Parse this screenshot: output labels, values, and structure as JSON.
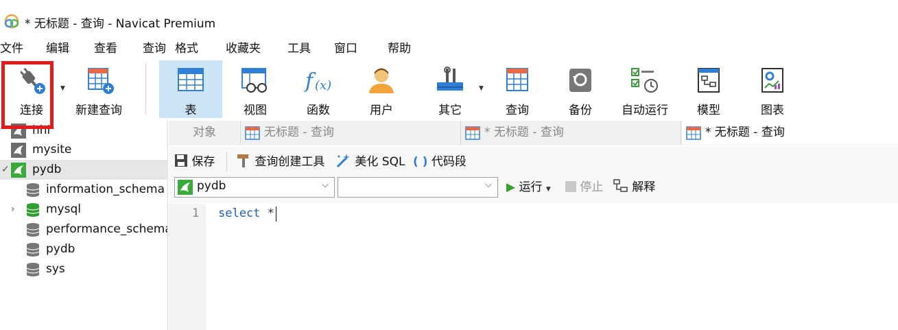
{
  "window": {
    "title": "* 无标题 - 查询 - Navicat Premium"
  },
  "menu": [
    "文件",
    "编辑",
    "查看",
    "查询",
    "格式",
    "收藏夹",
    "工具",
    "窗口",
    "帮助"
  ],
  "toolbar": {
    "connect": "连接",
    "new_query": "新建查询",
    "table": "表",
    "view": "视图",
    "function": "函数",
    "user": "用户",
    "other": "其它",
    "query": "查询",
    "backup": "备份",
    "auto_run": "自动运行",
    "model": "模型",
    "chart": "图表"
  },
  "sidebar": {
    "connections": [
      {
        "label": "hhl"
      },
      {
        "label": "mysite"
      },
      {
        "label": "pydb"
      }
    ],
    "databases": [
      {
        "label": "information_schema"
      },
      {
        "label": "mysql"
      },
      {
        "label": "performance_schema"
      },
      {
        "label": "pydb"
      },
      {
        "label": "sys"
      }
    ]
  },
  "tabs": [
    {
      "label": "对象"
    },
    {
      "label": "无标题 - 查询"
    },
    {
      "label": "* 无标题 - 查询"
    },
    {
      "label": "* 无标题 - 查询"
    }
  ],
  "editor_toolbar": {
    "save": "保存",
    "query_builder": "查询创建工具",
    "beautify": "美化 SQL",
    "snippet": "代码段",
    "run": "运行",
    "stop": "停止",
    "explain": "解释"
  },
  "db_select": {
    "value": "pydb"
  },
  "schema_select": {
    "value": ""
  },
  "editor": {
    "line_number": "1",
    "keyword": "select",
    "operator": "*"
  },
  "colors": {
    "accent": "#1a5fb4",
    "highlight": "#e11a1a",
    "active_tab_bg": "#cce4f7"
  }
}
